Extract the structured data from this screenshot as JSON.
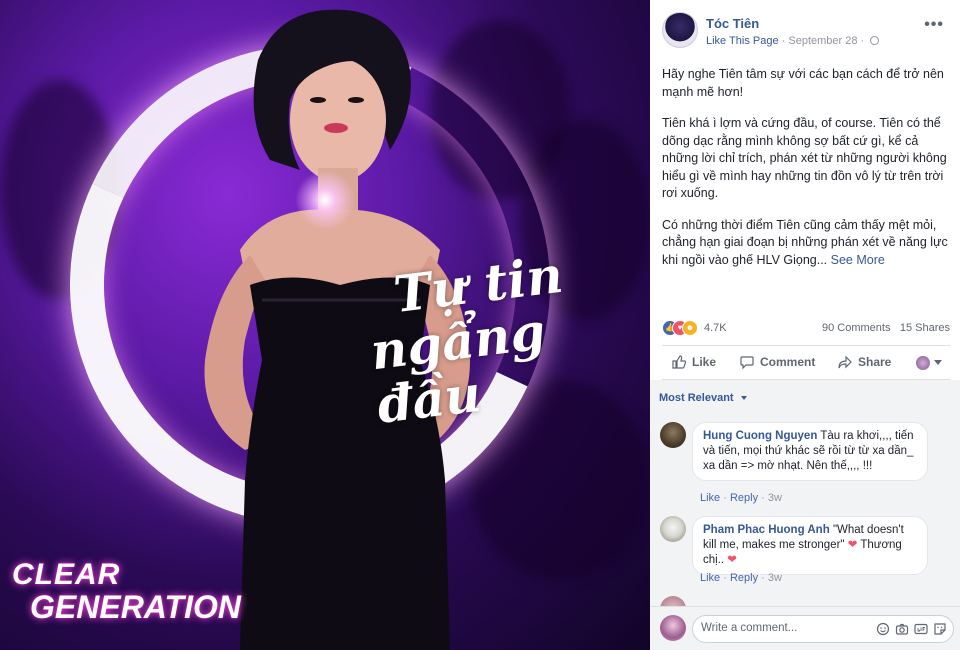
{
  "photo": {
    "slogan_line1": "Tự tin",
    "slogan_line2": "ngẩng đầu",
    "brand_line1": "CLEAR",
    "brand_line2": "GENERATION"
  },
  "post": {
    "page_name": "Tóc Tiên",
    "like_page": "Like This Page",
    "separator": "·",
    "date": "September 28",
    "paragraphs": [
      "Hãy nghe Tiên tâm sự với các bạn cách để trở nên mạnh mẽ hơn!",
      "Tiên khá ì lợm và cứng đầu, of course. Tiên có thể dõng dạc rằng mình không sợ bất cứ gì, kể cả những lời chỉ trích, phán xét từ những người không hiểu gì về mình hay những tin đồn vô lý từ trên trời rơi xuống.",
      "Có những thời điểm Tiên cũng cảm thấy mệt mỏi, chẳng hạn giai đoạn bị những phán xét về năng lực khi ngồi vào ghế HLV Giọng..."
    ],
    "see_more": "See More",
    "reaction_count": "4.7K",
    "comments_count": "90 Comments",
    "shares_count": "15 Shares"
  },
  "actions": {
    "like": "Like",
    "comment": "Comment",
    "share": "Share"
  },
  "comments": {
    "sort_label": "Most Relevant",
    "items": [
      {
        "name": "Hung Cuong Nguyen",
        "text": "Tàu ra khơi,,,, tiến và tiến, mọi thứ khác sẽ rồi từ từ xa dần_ xa dần => mờ nhạt. Nên thế,,,, !!!",
        "like": "Like",
        "reply": "Reply",
        "time": "3w"
      },
      {
        "name": "Pham Phac Huong Anh",
        "text": "\"What doesn't kill me, makes me stronger\"",
        "text2": "Thương chị..",
        "like": "Like",
        "reply": "Reply",
        "time": "3w"
      }
    ],
    "write_placeholder": "Write a comment..."
  },
  "colors": {
    "link": "#365899",
    "like_blue": "#4267b2",
    "love_red": "#f25268",
    "haha_yellow": "#f7b125"
  },
  "icons": [
    "globe-icon",
    "more-options-icon",
    "like-icon",
    "comment-icon",
    "share-icon",
    "emoji-icon",
    "camera-icon",
    "gif-icon",
    "sticker-icon"
  ]
}
